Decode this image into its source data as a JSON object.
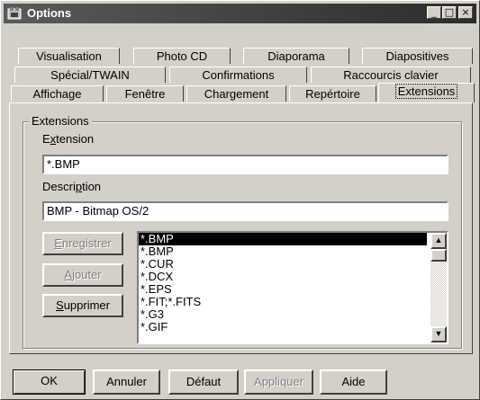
{
  "window": {
    "title": "Options"
  },
  "tabs_row1": [
    {
      "label": "Visualisation"
    },
    {
      "label": "Photo CD"
    },
    {
      "label": "Diaporama"
    },
    {
      "label": "Diapositives"
    }
  ],
  "tabs_row2": [
    {
      "label": "Spécial/TWAIN"
    },
    {
      "label": "Confirmations"
    },
    {
      "label": "Raccourcis clavier"
    }
  ],
  "tabs_row3": [
    {
      "label": "Affichage"
    },
    {
      "label": "Fenêtre"
    },
    {
      "label": "Chargement"
    },
    {
      "label": "Repértoire"
    },
    {
      "label": "Extensions"
    }
  ],
  "group": {
    "title": "Extensions",
    "extension_label_pre": "E",
    "extension_label_u": "x",
    "extension_label_post": "tension",
    "extension_value": "*.BMP",
    "description_label_pre": "Descri",
    "description_label_u": "p",
    "description_label_post": "tion",
    "description_value": "BMP - Bitmap OS/2",
    "register": {
      "u": "E",
      "rest": "nregistrer"
    },
    "add": {
      "u": "A",
      "rest": "jouter"
    },
    "delete": {
      "u": "S",
      "rest": "upprimer"
    },
    "list": [
      "*.BMP",
      "*.BMP",
      "*.CUR",
      "*.DCX",
      "*.EPS",
      "*.FIT;*.FITS",
      "*.G3",
      "*.GIF"
    ]
  },
  "footer": {
    "ok": "OK",
    "cancel": "Annuler",
    "default": "Défaut",
    "apply": "Appliquer",
    "help": "Aide"
  }
}
